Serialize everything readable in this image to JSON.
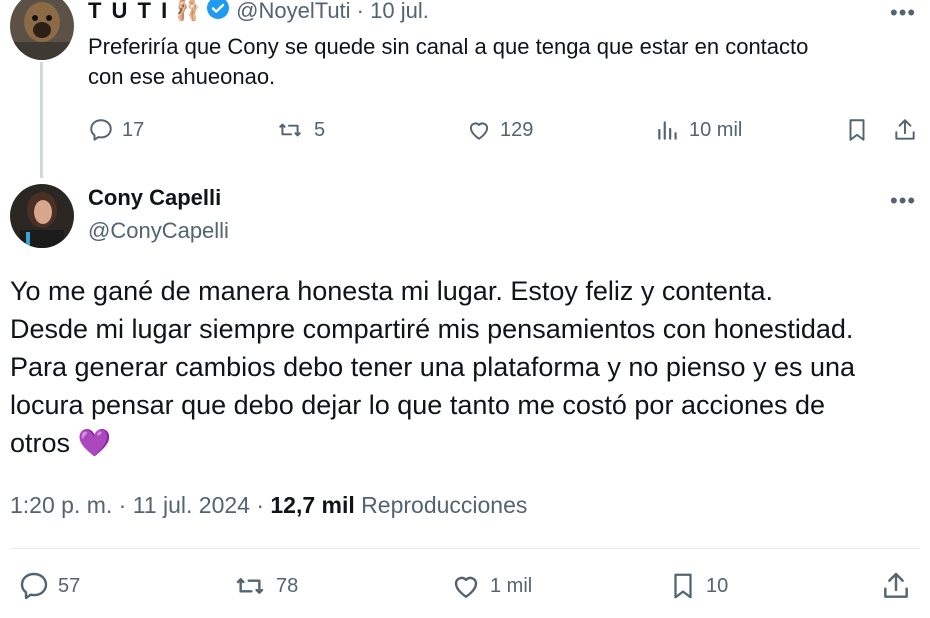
{
  "reply_tweet": {
    "author_name": "T U T I",
    "author_emoji": "🩰",
    "handle_date": "@NoyelTuti · 10 jul.",
    "more_label": "•••",
    "text_line1": "Preferiría que Cony se quede sin canal a que tenga que estar en contacto",
    "text_line2": "con ese ahueonao.",
    "replies": "17",
    "retweets": "5",
    "likes": "129",
    "views": "10 mil"
  },
  "main_tweet": {
    "author_name": "Cony Capelli",
    "handle": "@ConyCapelli",
    "more_label": "•••",
    "lines": [
      "Yo me gané de manera honesta mi lugar. Estoy feliz y contenta.",
      "Desde mi lugar siempre compartiré mis pensamientos con honestidad.",
      "Para generar cambios debo tener una plataforma y no pienso y es una",
      "locura pensar que debo dejar lo que tanto me costó por acciones de",
      "otros"
    ],
    "heart_emoji": "💜",
    "timestamp": "1:20 p. m. · 11 jul. 2024 · ",
    "views_count": "12,7 mil",
    "views_label": "Reproducciones",
    "replies": "57",
    "retweets": "78",
    "likes": "1 mil",
    "bookmarks": "10"
  },
  "colors": {
    "muted": "#536471",
    "verified": "#1d9bf0",
    "divider": "#e6ecf0",
    "heart": "#a77bd8"
  }
}
